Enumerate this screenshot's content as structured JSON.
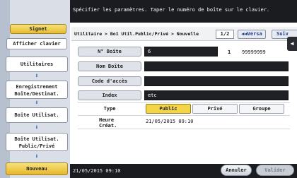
{
  "instruction": "Spécifier les paramètres. Taper le numéro de boîte sur le clavier.",
  "left_panel": {
    "signet_label": "Signet",
    "afficher_clavier_label": "Afficher clavier",
    "steps": {
      "utilitaires": "Utilitaires",
      "enregistrement": "Enregistrement\nBoîte/Destinat.",
      "boite_utilisat": "Boîte Utilisat.",
      "boite_utilisat_public": "Boîte Utilisat.\nPublic/Privé"
    },
    "nouveau_label": "Nouveau"
  },
  "breadcrumb": {
    "text": "Utilitaire > Boî Util.Public/Privé > Nouvelle",
    "page": "1/2",
    "prev_label": "◀◀Versa",
    "next_label": "Suiv"
  },
  "form": {
    "box_number": {
      "label": "N° Boîte",
      "value": "6",
      "count": "1",
      "mask": "99999999"
    },
    "box_name": {
      "label": "Nom Boîte",
      "value": ""
    },
    "password": {
      "label": "Code d'accès",
      "value": ""
    },
    "index": {
      "label": "Index",
      "value": "etc"
    },
    "type": {
      "label": "Type",
      "options": [
        "Public",
        "Privé",
        "Groupe"
      ],
      "selected": "Public"
    },
    "created": {
      "label": "Heure\nCréat.",
      "value": "21/05/2015  09:10"
    }
  },
  "status": {
    "datetime": "21/05/2015   09:10"
  },
  "footer": {
    "cancel_label": "Annuler",
    "ok_label": "Valider"
  },
  "colors": {
    "accent_yellow": "#f4d548",
    "field_dark": "#1e2024",
    "screen_bg": "#1a1c1f"
  }
}
